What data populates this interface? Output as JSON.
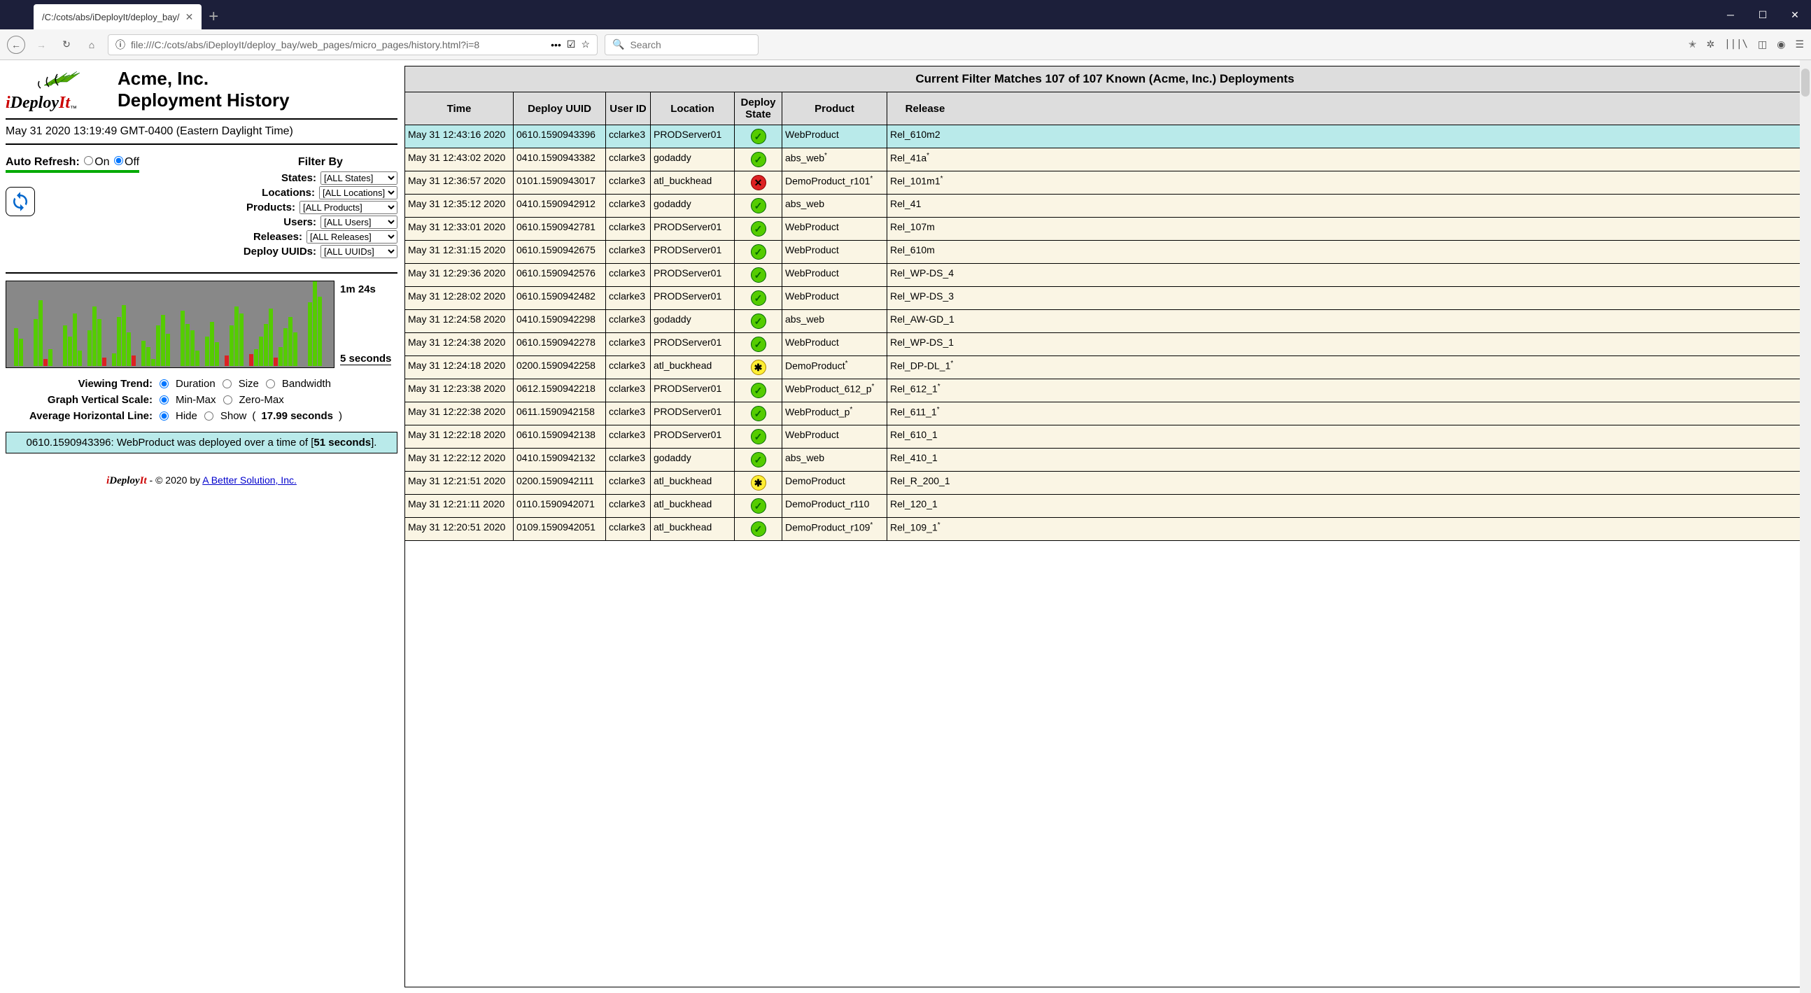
{
  "browser": {
    "tab_title": "/C:/cots/abs/iDeployIt/deploy_bay/",
    "url": "file:///C:/cots/abs/iDeployIt/deploy_bay/web_pages/micro_pages/history.html?i=8",
    "search_placeholder": "Search"
  },
  "header": {
    "company": "Acme, Inc.",
    "page": "Deployment History",
    "logo_text_i": "i",
    "logo_text_deploy": "Deploy",
    "logo_text_it": "It",
    "logo_tm": "™"
  },
  "timestamp": "May 31 2020 13:19:49 GMT-0400 (Eastern Daylight Time)",
  "auto_refresh": {
    "label": "Auto Refresh:",
    "on": "On",
    "off": "Off",
    "selected": "Off"
  },
  "filter": {
    "title": "Filter By",
    "states": {
      "label": "States:",
      "value": "[ALL States]"
    },
    "locations": {
      "label": "Locations:",
      "value": "[ALL Locations]"
    },
    "products": {
      "label": "Products:",
      "value": "[ALL Products]"
    },
    "users": {
      "label": "Users:",
      "value": "[ALL Users]"
    },
    "releases": {
      "label": "Releases:",
      "value": "[ALL Releases]"
    },
    "uuids": {
      "label": "Deploy UUIDs:",
      "value": "[ALL UUIDs]"
    }
  },
  "chart_data": {
    "type": "bar",
    "ylabel_top": "1m 24s",
    "ylabel_bottom": "5 seconds",
    "bars": [
      {
        "h": 0
      },
      {
        "h": 45
      },
      {
        "h": 32
      },
      {
        "h": 0
      },
      {
        "h": 0
      },
      {
        "h": 55
      },
      {
        "h": 78
      },
      {
        "h": 8,
        "red": true
      },
      {
        "h": 20
      },
      {
        "h": 0
      },
      {
        "h": 0
      },
      {
        "h": 48
      },
      {
        "h": 35
      },
      {
        "h": 62
      },
      {
        "h": 18
      },
      {
        "h": 0
      },
      {
        "h": 42
      },
      {
        "h": 70
      },
      {
        "h": 55
      },
      {
        "h": 10,
        "red": true
      },
      {
        "h": 0
      },
      {
        "h": 15
      },
      {
        "h": 58
      },
      {
        "h": 72
      },
      {
        "h": 40
      },
      {
        "h": 12,
        "red": true
      },
      {
        "h": 0
      },
      {
        "h": 30
      },
      {
        "h": 22
      },
      {
        "h": 8
      },
      {
        "h": 48
      },
      {
        "h": 60
      },
      {
        "h": 38
      },
      {
        "h": 0
      },
      {
        "h": 0
      },
      {
        "h": 65
      },
      {
        "h": 50
      },
      {
        "h": 42
      },
      {
        "h": 18
      },
      {
        "h": 0
      },
      {
        "h": 35
      },
      {
        "h": 52
      },
      {
        "h": 28
      },
      {
        "h": 0
      },
      {
        "h": 12,
        "red": true
      },
      {
        "h": 48
      },
      {
        "h": 70
      },
      {
        "h": 62
      },
      {
        "h": 0
      },
      {
        "h": 14,
        "red": true
      },
      {
        "h": 20
      },
      {
        "h": 35
      },
      {
        "h": 50
      },
      {
        "h": 68
      },
      {
        "h": 10,
        "red": true
      },
      {
        "h": 22
      },
      {
        "h": 45
      },
      {
        "h": 58
      },
      {
        "h": 40
      },
      {
        "h": 0
      },
      {
        "h": 0
      },
      {
        "h": 75
      },
      {
        "h": 100
      },
      {
        "h": 82
      }
    ],
    "title": "",
    "xlabel": ""
  },
  "chart_opts": {
    "trend": {
      "label": "Viewing Trend:",
      "options": [
        "Duration",
        "Size",
        "Bandwidth"
      ],
      "selected": "Duration"
    },
    "scale": {
      "label": "Graph Vertical Scale:",
      "options": [
        "Min-Max",
        "Zero-Max"
      ],
      "selected": "Min-Max"
    },
    "avg": {
      "label": "Average Horizontal Line:",
      "options": [
        "Hide",
        "Show"
      ],
      "selected": "Hide",
      "suffix_open": " (",
      "suffix_value": "17.99 seconds",
      "suffix_close": ")"
    }
  },
  "status": {
    "prefix": "0610.1590943396: WebProduct was deployed over a time of [",
    "value": "51 seconds",
    "suffix": "]."
  },
  "footer": {
    "copyright": " - © 2020 by ",
    "company": "A Better Solution, Inc."
  },
  "table": {
    "title": "Current Filter Matches 107 of 107 Known (Acme, Inc.) Deployments",
    "headers": {
      "time": "Time",
      "uuid": "Deploy UUID",
      "user": "User ID",
      "location": "Location",
      "state": "Deploy State",
      "product": "Product",
      "release": "Release"
    },
    "rows": [
      {
        "time": "May 31 12:43:16 2020",
        "uuid": "0610.1590943396",
        "user": "cclarke3",
        "location": "PRODServer01",
        "state": "ok",
        "product": "WebProduct",
        "release": "Rel_610m2",
        "selected": true
      },
      {
        "time": "May 31 12:43:02 2020",
        "uuid": "0410.1590943382",
        "user": "cclarke3",
        "location": "godaddy",
        "state": "ok",
        "product": "abs_web*",
        "release": "Rel_41a*"
      },
      {
        "time": "May 31 12:36:57 2020",
        "uuid": "0101.1590943017",
        "user": "cclarke3",
        "location": "atl_buckhead",
        "state": "err",
        "product": "DemoProduct_r101*",
        "release": "Rel_101m1*"
      },
      {
        "time": "May 31 12:35:12 2020",
        "uuid": "0410.1590942912",
        "user": "cclarke3",
        "location": "godaddy",
        "state": "ok",
        "product": "abs_web",
        "release": "Rel_41"
      },
      {
        "time": "May 31 12:33:01 2020",
        "uuid": "0610.1590942781",
        "user": "cclarke3",
        "location": "PRODServer01",
        "state": "ok",
        "product": "WebProduct",
        "release": "Rel_107m"
      },
      {
        "time": "May 31 12:31:15 2020",
        "uuid": "0610.1590942675",
        "user": "cclarke3",
        "location": "PRODServer01",
        "state": "ok",
        "product": "WebProduct",
        "release": "Rel_610m"
      },
      {
        "time": "May 31 12:29:36 2020",
        "uuid": "0610.1590942576",
        "user": "cclarke3",
        "location": "PRODServer01",
        "state": "ok",
        "product": "WebProduct",
        "release": "Rel_WP-DS_4"
      },
      {
        "time": "May 31 12:28:02 2020",
        "uuid": "0610.1590942482",
        "user": "cclarke3",
        "location": "PRODServer01",
        "state": "ok",
        "product": "WebProduct",
        "release": "Rel_WP-DS_3"
      },
      {
        "time": "May 31 12:24:58 2020",
        "uuid": "0410.1590942298",
        "user": "cclarke3",
        "location": "godaddy",
        "state": "ok",
        "product": "abs_web",
        "release": "Rel_AW-GD_1"
      },
      {
        "time": "May 31 12:24:38 2020",
        "uuid": "0610.1590942278",
        "user": "cclarke3",
        "location": "PRODServer01",
        "state": "ok",
        "product": "WebProduct",
        "release": "Rel_WP-DS_1"
      },
      {
        "time": "May 31 12:24:18 2020",
        "uuid": "0200.1590942258",
        "user": "cclarke3",
        "location": "atl_buckhead",
        "state": "warn",
        "product": "DemoProduct*",
        "release": "Rel_DP-DL_1*"
      },
      {
        "time": "May 31 12:23:38 2020",
        "uuid": "0612.1590942218",
        "user": "cclarke3",
        "location": "PRODServer01",
        "state": "ok",
        "product": "WebProduct_612_p*",
        "release": "Rel_612_1*"
      },
      {
        "time": "May 31 12:22:38 2020",
        "uuid": "0611.1590942158",
        "user": "cclarke3",
        "location": "PRODServer01",
        "state": "ok",
        "product": "WebProduct_p*",
        "release": "Rel_611_1*"
      },
      {
        "time": "May 31 12:22:18 2020",
        "uuid": "0610.1590942138",
        "user": "cclarke3",
        "location": "PRODServer01",
        "state": "ok",
        "product": "WebProduct",
        "release": "Rel_610_1"
      },
      {
        "time": "May 31 12:22:12 2020",
        "uuid": "0410.1590942132",
        "user": "cclarke3",
        "location": "godaddy",
        "state": "ok",
        "product": "abs_web",
        "release": "Rel_410_1"
      },
      {
        "time": "May 31 12:21:51 2020",
        "uuid": "0200.1590942111",
        "user": "cclarke3",
        "location": "atl_buckhead",
        "state": "warn",
        "product": "DemoProduct",
        "release": "Rel_R_200_1"
      },
      {
        "time": "May 31 12:21:11 2020",
        "uuid": "0110.1590942071",
        "user": "cclarke3",
        "location": "atl_buckhead",
        "state": "ok",
        "product": "DemoProduct_r110",
        "release": "Rel_120_1"
      },
      {
        "time": "May 31 12:20:51 2020",
        "uuid": "0109.1590942051",
        "user": "cclarke3",
        "location": "atl_buckhead",
        "state": "ok",
        "product": "DemoProduct_r109*",
        "release": "Rel_109_1*"
      }
    ]
  }
}
